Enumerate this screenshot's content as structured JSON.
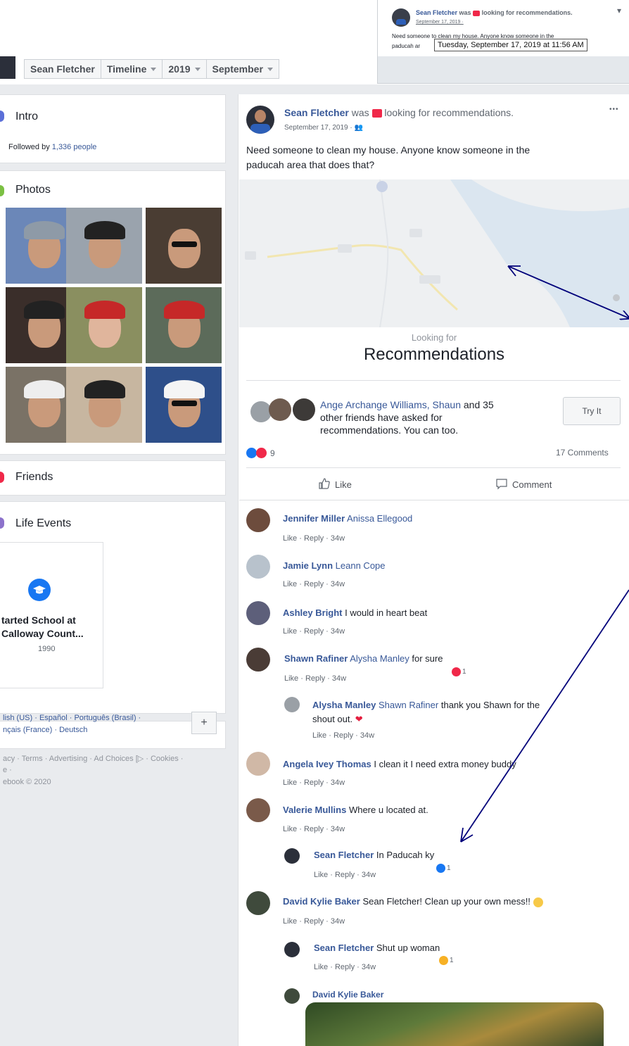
{
  "inset": {
    "name": "Sean Fletcher",
    "was": "was",
    "activity": "looking for recommendations.",
    "date": "September 17, 2019 ·",
    "text_line1": "Need someone to clean my house. Anyone know someone in the",
    "text_line2": "paducah ar",
    "tooltip": "Tuesday, September 17, 2019 at 11:56 AM"
  },
  "breadcrumb": {
    "name": "Sean Fletcher",
    "timeline": "Timeline",
    "year": "2019",
    "month": "September"
  },
  "sidebar": {
    "intro_title": "Intro",
    "followed_prefix": "Followed by ",
    "followed_count": "1,336 people",
    "photos_title": "Photos",
    "friends_title": "Friends",
    "life_events_title": "Life Events",
    "life_event_line1": "tarted School at",
    "life_event_line2": "Calloway Count...",
    "life_event_year": "1990",
    "languages_line1": "lish (US) · Español · Português (Brasil) ·",
    "languages_line2": "nçais (France) · Deutsch",
    "add_language": "+",
    "footer_line1": "acy · Terms · Advertising · Ad Choices [▷ · Cookies ·",
    "footer_line2": "e ·",
    "footer_line3": "ebook © 2020"
  },
  "post": {
    "author": "Sean Fletcher",
    "was": "was",
    "activity": "looking for recommendations.",
    "date": "September 17, 2019 ·",
    "more": "•••",
    "text_line1": "Need someone to clean my house. Anyone know someone in the",
    "text_line2": "paducah area that does that?",
    "looking_for": "Looking for",
    "recommendations": "Recommendations",
    "asked_names": "Ange Archange Williams, Shaun",
    "asked_and": " and 35",
    "asked_line2": "other friends have asked for",
    "asked_line3": "recommendations. You can too.",
    "try_it": "Try It",
    "reaction_count": "9",
    "comments_count": "17 Comments",
    "like_action": "Like",
    "comment_action": "Comment"
  },
  "comments": [
    {
      "name": "Jennifer Miller",
      "tag": "Anissa Ellegood",
      "text": "",
      "meta": "Like · Reply · 34w"
    },
    {
      "name": "Jamie Lynn",
      "tag": "Leann Cope",
      "text": "",
      "meta": "Like · Reply · 34w"
    },
    {
      "name": "Ashley Bright",
      "tag": "",
      "text": "I would in heart beat",
      "meta": "Like · Reply · 34w"
    },
    {
      "name": "Shawn Rafiner",
      "tag": "Alysha Manley",
      "text": "for sure",
      "meta": "Like · Reply · 34w",
      "reaction": "1"
    },
    {
      "name": "Alysha Manley",
      "tag": "Shawn Rafiner",
      "text": "thank you Shawn for the",
      "text2": "shout out.",
      "meta": "Like · Reply · 34w"
    },
    {
      "name": "Angela Ivey Thomas",
      "tag": "",
      "text": "I clean it I need extra money buddy",
      "meta": "Like · Reply · 34w"
    },
    {
      "name": "Valerie Mullins",
      "tag": "",
      "text": "Where u located at.",
      "meta": "Like · Reply · 34w"
    },
    {
      "name": "Sean Fletcher",
      "tag": "",
      "text": "In Paducah ky",
      "meta": "Like · Reply · 34w",
      "reaction": "1"
    },
    {
      "name": "David Kylie Baker",
      "tag": "",
      "text": "Sean Fletcher! Clean up your own mess!!",
      "meta": "Like · Reply · 34w"
    },
    {
      "name": "Sean Fletcher",
      "tag": "",
      "text": "Shut up woman",
      "meta": "Like · Reply · 34w",
      "reaction": "1"
    },
    {
      "name": "David Kylie Baker",
      "tag": "",
      "text": "",
      "meta": ""
    }
  ]
}
